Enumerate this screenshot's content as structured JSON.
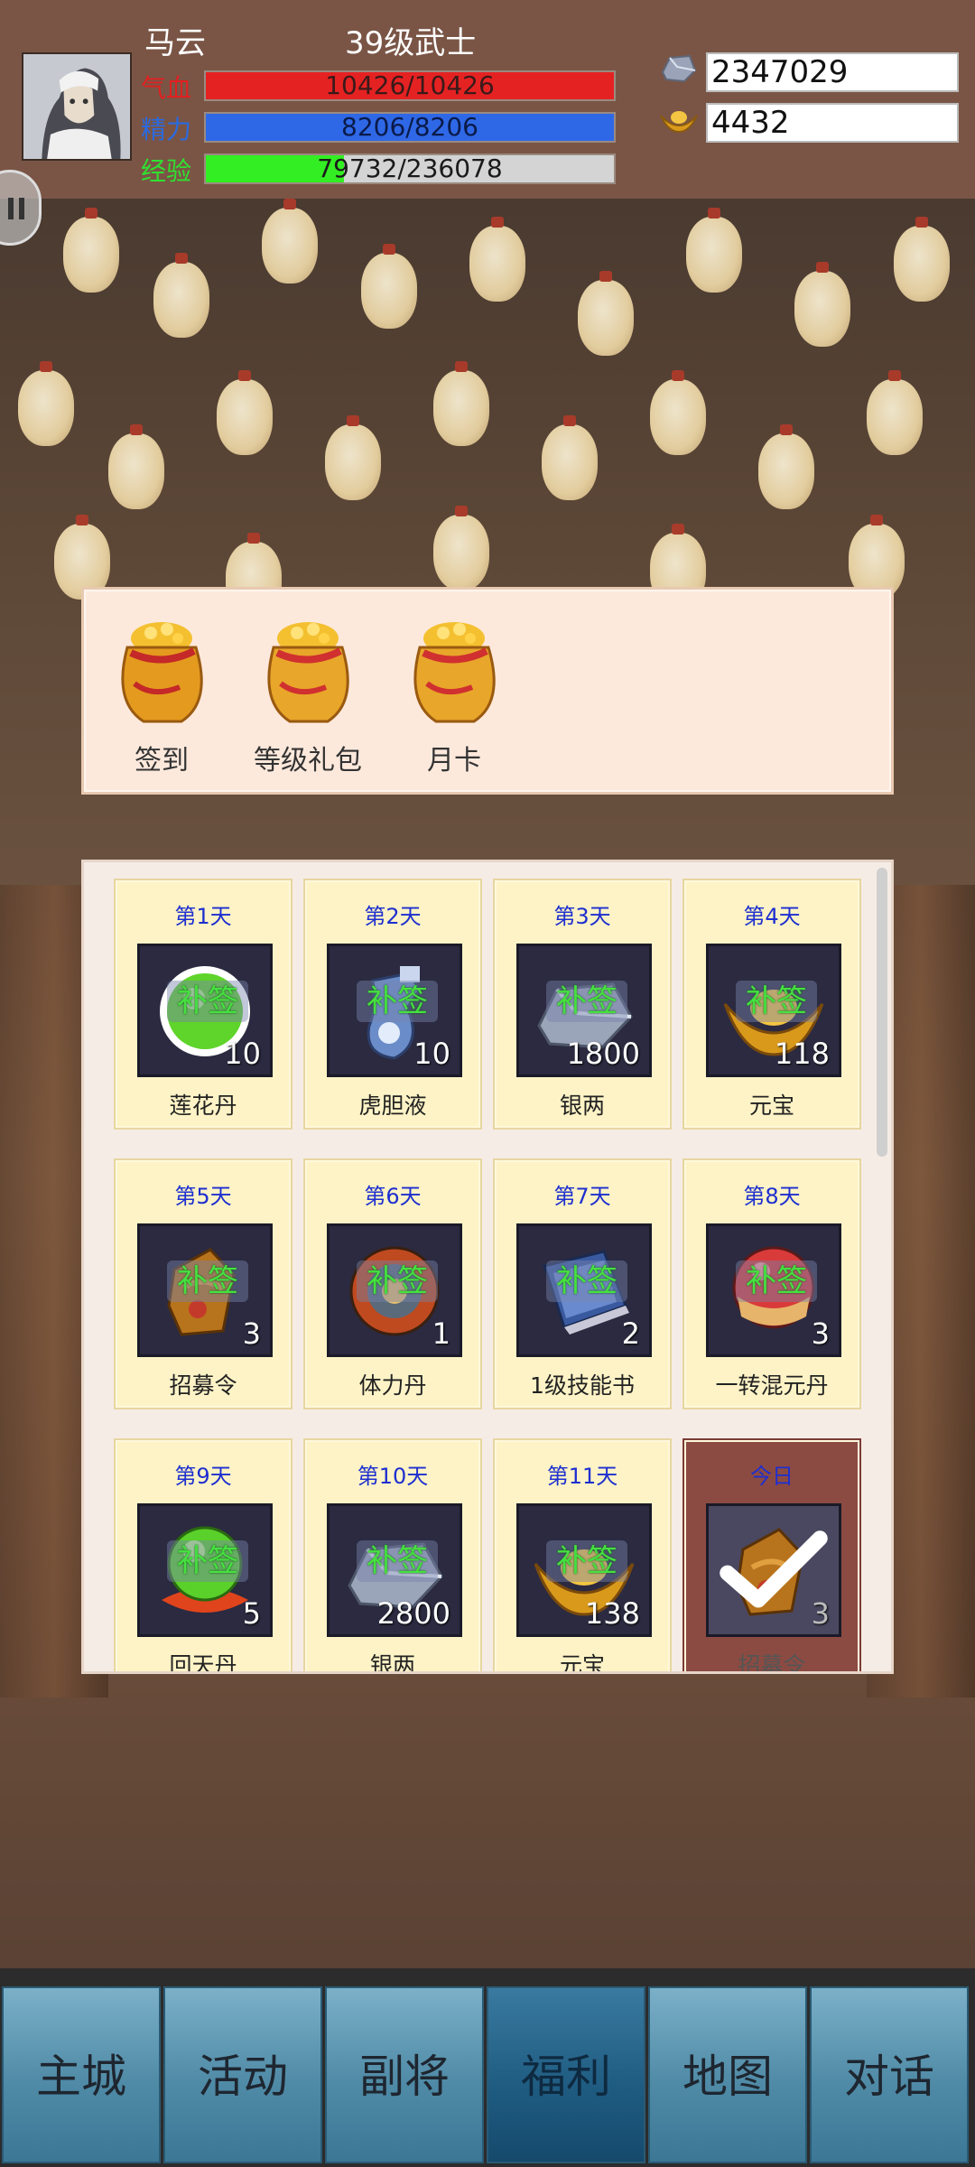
{
  "player": {
    "name": "马云",
    "level_title": "39级武士",
    "hp_label": "气血",
    "hp_text": "10426/10426",
    "hp_fraction": 1.0,
    "mp_label": "精力",
    "mp_text": "8206/8206",
    "mp_fraction": 1.0,
    "exp_label": "经验",
    "exp_text": "79732/236078",
    "exp_fraction": 0.338
  },
  "currency": {
    "silver_icon": "silver-ingot-icon",
    "silver": "2347029",
    "gold_icon": "gold-yuanbao-icon",
    "gold": "4432"
  },
  "welfare_tabs": [
    {
      "label": "签到",
      "icon": "money-bag-icon"
    },
    {
      "label": "等级礼包",
      "icon": "money-bag-icon"
    },
    {
      "label": "月卡",
      "icon": "money-bag-icon"
    }
  ],
  "signin": {
    "makeup_label": "补签",
    "days": [
      {
        "day": "第1天",
        "item": "莲花丹",
        "qty": "10",
        "icon": "green-pill-icon"
      },
      {
        "day": "第2天",
        "item": "虎胆液",
        "qty": "10",
        "icon": "potion-bottle-icon"
      },
      {
        "day": "第3天",
        "item": "银两",
        "qty": "1800",
        "icon": "silver-ingot-icon"
      },
      {
        "day": "第4天",
        "item": "元宝",
        "qty": "118",
        "icon": "gold-yuanbao-icon"
      },
      {
        "day": "第5天",
        "item": "招募令",
        "qty": "3",
        "icon": "recruit-token-icon"
      },
      {
        "day": "第6天",
        "item": "体力丹",
        "qty": "1",
        "icon": "stamina-pill-icon"
      },
      {
        "day": "第7天",
        "item": "1级技能书",
        "qty": "2",
        "icon": "skill-book-icon"
      },
      {
        "day": "第8天",
        "item": "一转混元丹",
        "qty": "3",
        "icon": "red-pill-icon"
      },
      {
        "day": "第9天",
        "item": "回天丹",
        "qty": "5",
        "icon": "green-orb-icon"
      },
      {
        "day": "第10天",
        "item": "银两",
        "qty": "2800",
        "icon": "silver-ingot-icon"
      },
      {
        "day": "第11天",
        "item": "元宝",
        "qty": "138",
        "icon": "gold-yuanbao-icon"
      },
      {
        "day": "今日",
        "item": "招募令",
        "qty": "3",
        "icon": "recruit-token-icon",
        "claimed": true
      }
    ]
  },
  "nav": {
    "items": [
      "主城",
      "活动",
      "副将",
      "福利",
      "地图",
      "对话"
    ],
    "active": "福利"
  }
}
